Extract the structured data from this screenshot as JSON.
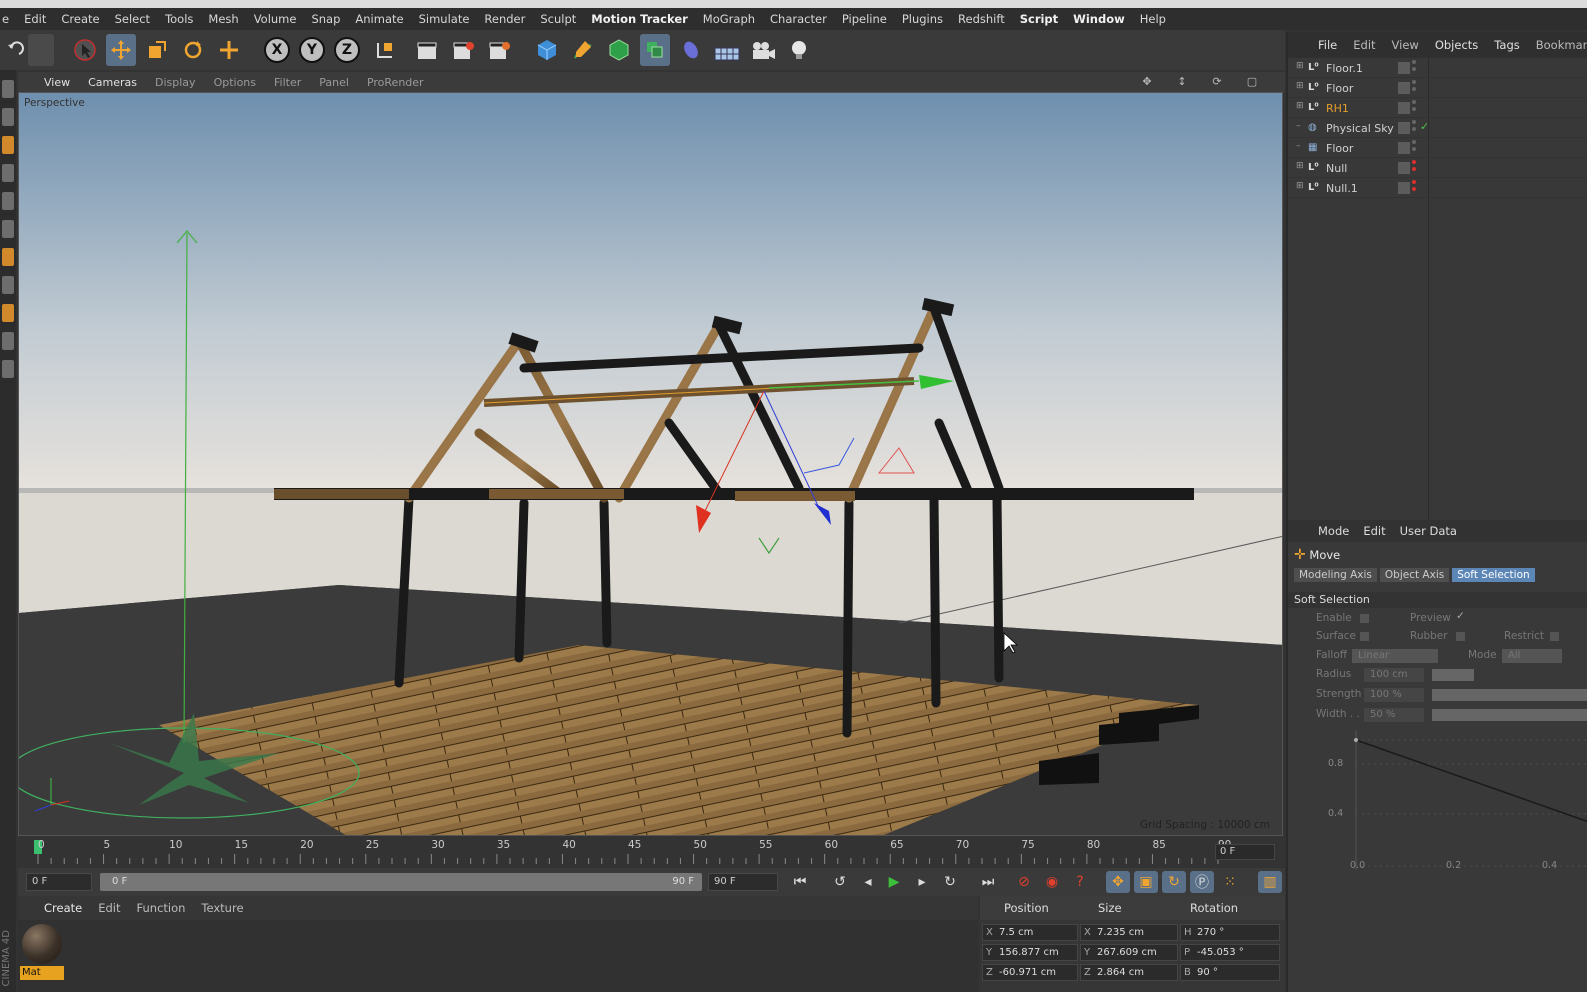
{
  "menu": [
    "e",
    "Edit",
    "Create",
    "Select",
    "Tools",
    "Mesh",
    "Volume",
    "Snap",
    "Animate",
    "Simulate",
    "Render",
    "Sculpt",
    "Motion Tracker",
    "MoGraph",
    "Character",
    "Pipeline",
    "Plugins",
    "Redshift",
    "Script",
    "Window",
    "Help"
  ],
  "toolbar": {
    "axis_x": "X",
    "axis_y": "Y",
    "axis_z": "Z"
  },
  "viewport": {
    "menu": [
      "View",
      "Cameras",
      "Display",
      "Options",
      "Filter",
      "Panel",
      "ProRender"
    ],
    "camera_label": "Perspective",
    "grid_spacing": "Grid Spacing : 10000 cm"
  },
  "timeline": {
    "ticks": [
      "0",
      "5",
      "10",
      "15",
      "20",
      "25",
      "30",
      "35",
      "40",
      "45",
      "50",
      "55",
      "60",
      "65",
      "70",
      "75",
      "80",
      "85",
      "90"
    ],
    "current_frame": "0 F"
  },
  "transport": {
    "start_field": "0 F",
    "slider_start": "0 F",
    "slider_end": "90 F",
    "end_field": "90 F"
  },
  "material_panel": {
    "menu": [
      "Create",
      "Edit",
      "Function",
      "Texture"
    ],
    "material_name": "Mat"
  },
  "coordinates": {
    "headers": {
      "position": "Position",
      "size": "Size",
      "rotation": "Rotation"
    },
    "rows": [
      {
        "pos_axis": "X",
        "pos": "7.5 cm",
        "size_axis": "X",
        "size": "7.235 cm",
        "rot_axis": "H",
        "rot": "270 °"
      },
      {
        "pos_axis": "Y",
        "pos": "156.877 cm",
        "size_axis": "Y",
        "size": "267.609 cm",
        "rot_axis": "P",
        "rot": "-45.053 °"
      },
      {
        "pos_axis": "Z",
        "pos": "-60.971 cm",
        "size_axis": "Z",
        "size": "2.864 cm",
        "rot_axis": "B",
        "rot": "90 °"
      }
    ]
  },
  "object_manager": {
    "menu": [
      "File",
      "Edit",
      "View",
      "Objects",
      "Tags",
      "Bookmarks"
    ],
    "objects": [
      {
        "name": "Floor.1",
        "icon": "null-icon",
        "highlight": false,
        "dots": "grey"
      },
      {
        "name": "Floor",
        "icon": "null-icon",
        "highlight": false,
        "dots": "grey"
      },
      {
        "name": "RH1",
        "icon": "null-icon",
        "highlight": true,
        "dots": "grey"
      },
      {
        "name": "Physical Sky",
        "icon": "sky-icon",
        "highlight": false,
        "dots": "grey",
        "check": "✓"
      },
      {
        "name": "Floor",
        "icon": "floor-icon",
        "highlight": false,
        "dots": "grey"
      },
      {
        "name": "Null",
        "icon": "null-icon",
        "highlight": false,
        "dots": "red"
      },
      {
        "name": "Null.1",
        "icon": "null-icon",
        "highlight": false,
        "dots": "red"
      }
    ]
  },
  "attribute_manager": {
    "menu": [
      "Mode",
      "Edit",
      "User Data"
    ],
    "tool_title": "Move",
    "tabs": [
      "Modeling Axis",
      "Object Axis",
      "Soft Selection"
    ],
    "section": "Soft Selection",
    "labels": {
      "enable": "Enable",
      "preview": "Preview",
      "preview_check": "✓",
      "surface": "Surface",
      "rubber": "Rubber",
      "restrict": "Restrict",
      "falloff": "Falloff",
      "falloff_value": "Linear",
      "mode": "Mode",
      "mode_value": "All",
      "radius": "Radius",
      "radius_value": "100 cm",
      "strength": "Strength",
      "strength_value": "100 %",
      "width": "Width . .",
      "width_value": "50 %"
    },
    "graph": {
      "y_labels": [
        "0.8",
        "0.4"
      ],
      "x_labels": [
        "0.0",
        "0.2",
        "0.4"
      ]
    }
  },
  "colors": {
    "accent_orange": "#e39d2c",
    "selected_blue": "#5b86b5",
    "sky_top": "#6e8fae",
    "sky_bottom": "#e7e2dc",
    "floor": "#3a3a3a"
  }
}
